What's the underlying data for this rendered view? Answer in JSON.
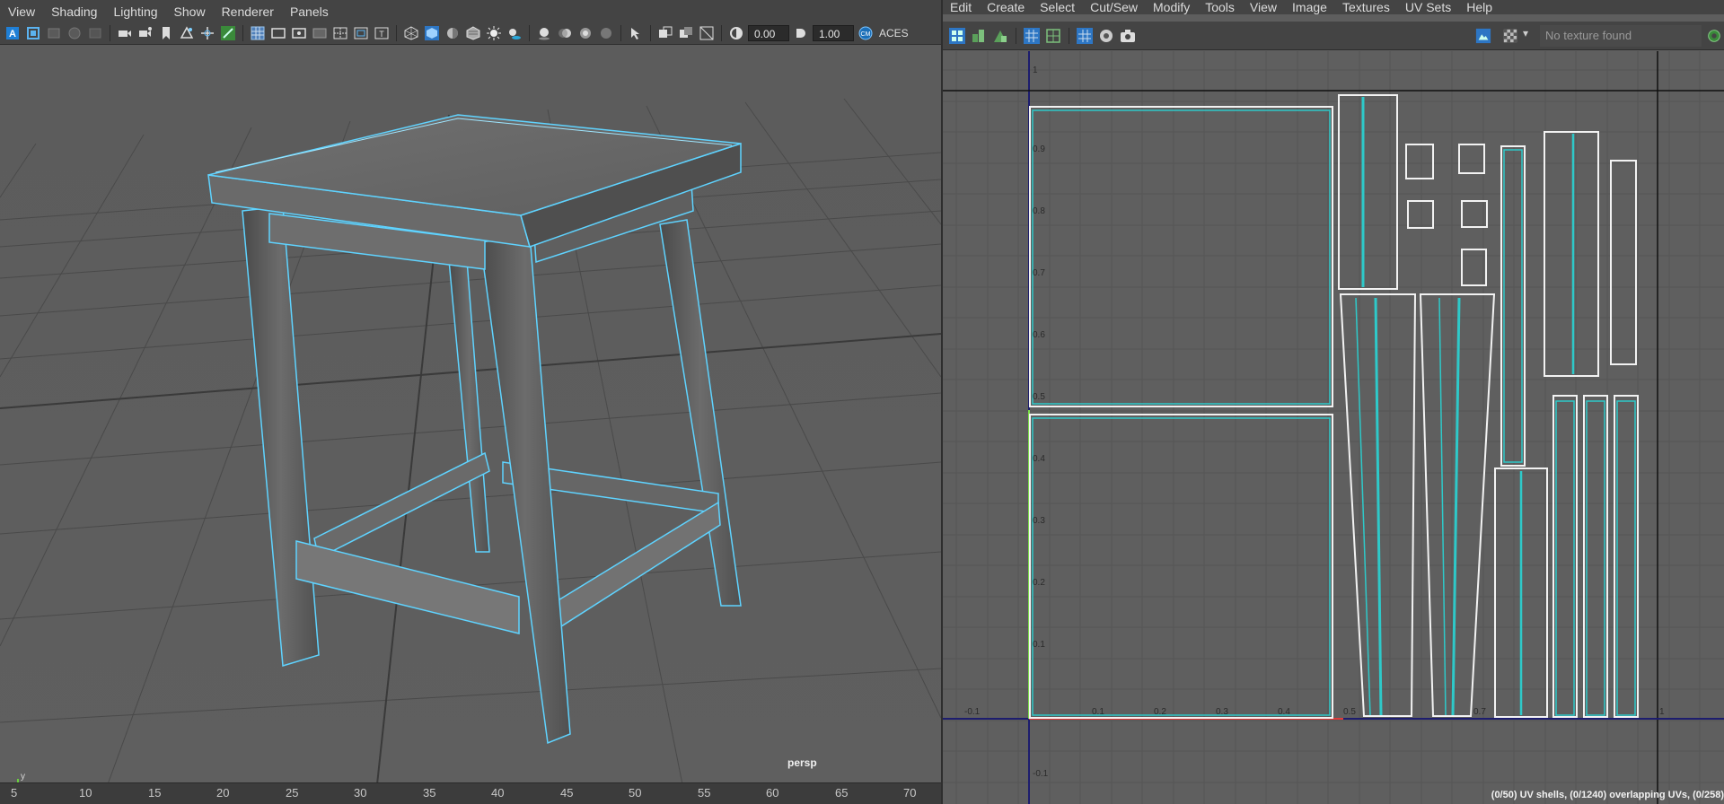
{
  "viewport_panel": {
    "menu": [
      "View",
      "Shading",
      "Lighting",
      "Show",
      "Renderer",
      "Panels"
    ],
    "toolbar": {
      "field_a": "0.00",
      "field_b": "1.00",
      "color_mgmt_label": "ACES",
      "icons": [
        "select-camera-icon",
        "camera-attributes-icon",
        "bookmark-icon",
        "image-plane-icon",
        "grid-icon",
        "film-gate-icon",
        "resolution-gate-icon",
        "gate-mask-icon",
        "field-chart-icon",
        "safe-action-icon",
        "safe-title-icon",
        "wireframe-icon",
        "smooth-shade-icon",
        "default-material-icon",
        "textured-icon",
        "lights-icon",
        "shadows-icon",
        "ambient-occlusion-icon",
        "motion-blur-icon",
        "antialiasing-icon",
        "depth-of-field-icon",
        "isolate-select-icon",
        "xray-icon",
        "xray-joints-icon",
        "xray-components-icon",
        "exposure-icon",
        "gamma-icon",
        "color-management-icon"
      ]
    },
    "camera_label": "persp",
    "axis_labels": {
      "y": "y",
      "z": "z"
    },
    "timeline_labels": [
      "5",
      "10",
      "15",
      "20",
      "25",
      "30",
      "35",
      "40",
      "45",
      "50",
      "55",
      "60",
      "65",
      "70"
    ]
  },
  "uv_panel": {
    "menu": [
      "Edit",
      "Create",
      "Select",
      "Cut/Sew",
      "Modify",
      "Tools",
      "View",
      "Image",
      "Textures",
      "UV Sets",
      "Help"
    ],
    "texture_field": "No texture found",
    "x_ticks": [
      "-0.1",
      "0.1",
      "0.2",
      "0.3",
      "0.4",
      "0.5",
      "0.7",
      "1"
    ],
    "y_ticks": [
      "1",
      "0.9",
      "0.8",
      "0.7",
      "0.6",
      "0.5",
      "0.4",
      "0.3",
      "0.2",
      "0.1",
      "-0.1"
    ],
    "status": "(0/50) UV shells, (0/1240) overlapping UVs, (0/258)"
  },
  "colors": {
    "wire_highlight": "#5fd3ff",
    "uv_shell_line": "#2ec9c9",
    "uv_axis_u": "#e03b3b",
    "uv_axis_v": "#7de04a",
    "uv_border": "#1d1d6e"
  }
}
